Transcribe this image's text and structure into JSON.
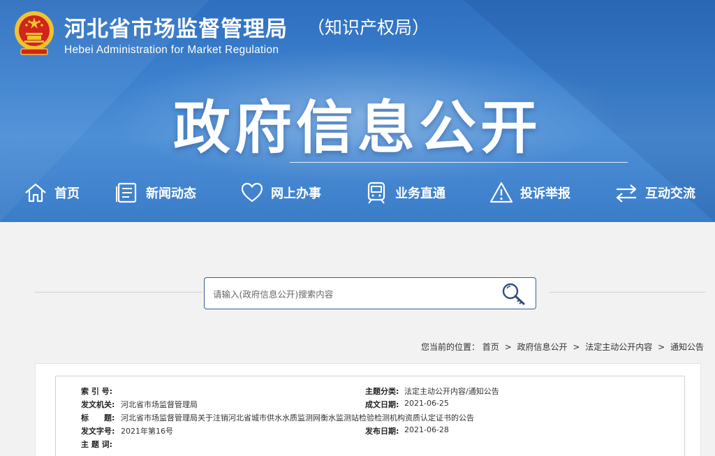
{
  "header": {
    "org_name_cn": "河北省市场监督管理局",
    "org_sub_cn": "（知识产权局）",
    "org_name_en": "Hebei Administration for Market Regulation",
    "banner_title": "政府信息公开"
  },
  "nav": {
    "items": [
      {
        "label": "首页",
        "icon": "home-icon"
      },
      {
        "label": "新闻动态",
        "icon": "news-icon"
      },
      {
        "label": "网上办事",
        "icon": "heart-icon"
      },
      {
        "label": "业务直通",
        "icon": "train-icon"
      },
      {
        "label": "投诉举报",
        "icon": "warning-icon"
      },
      {
        "label": "互动交流",
        "icon": "exchange-icon"
      }
    ]
  },
  "search": {
    "placeholder": "请输入(政府信息公开)搜索内容",
    "icon": "search-icon"
  },
  "breadcrumb": {
    "prefix": "您当前的位置：",
    "items": [
      "首页",
      "政府信息公开",
      "法定主动公开内容",
      "通知公告"
    ]
  },
  "meta": {
    "index_label": "索 引 号:",
    "index_value": "",
    "category_label": "主题分类:",
    "category_value": "法定主动公开内容/通知公告",
    "issuer_label": "发文机关:",
    "issuer_value": "河北省市场监督管理局",
    "created_label": "成文日期:",
    "created_value": "2021-06-25",
    "title_label": "标　　题:",
    "title_value": "河北省市场监督管理局关于注销河北省城市供水水质监测网衡水监测站检验检测机构资质认定证书的公告",
    "doc_no_label": "发文字号:",
    "doc_no_value": "2021年第16号",
    "published_label": "发布日期:",
    "published_value": "2021-06-28",
    "keywords_label": "主 题 词:",
    "keywords_value": ""
  },
  "colors": {
    "header_blue": "#3d82cf",
    "search_border": "#2f5f9e",
    "emblem_red": "#d0241c",
    "emblem_gold": "#f2c230"
  }
}
